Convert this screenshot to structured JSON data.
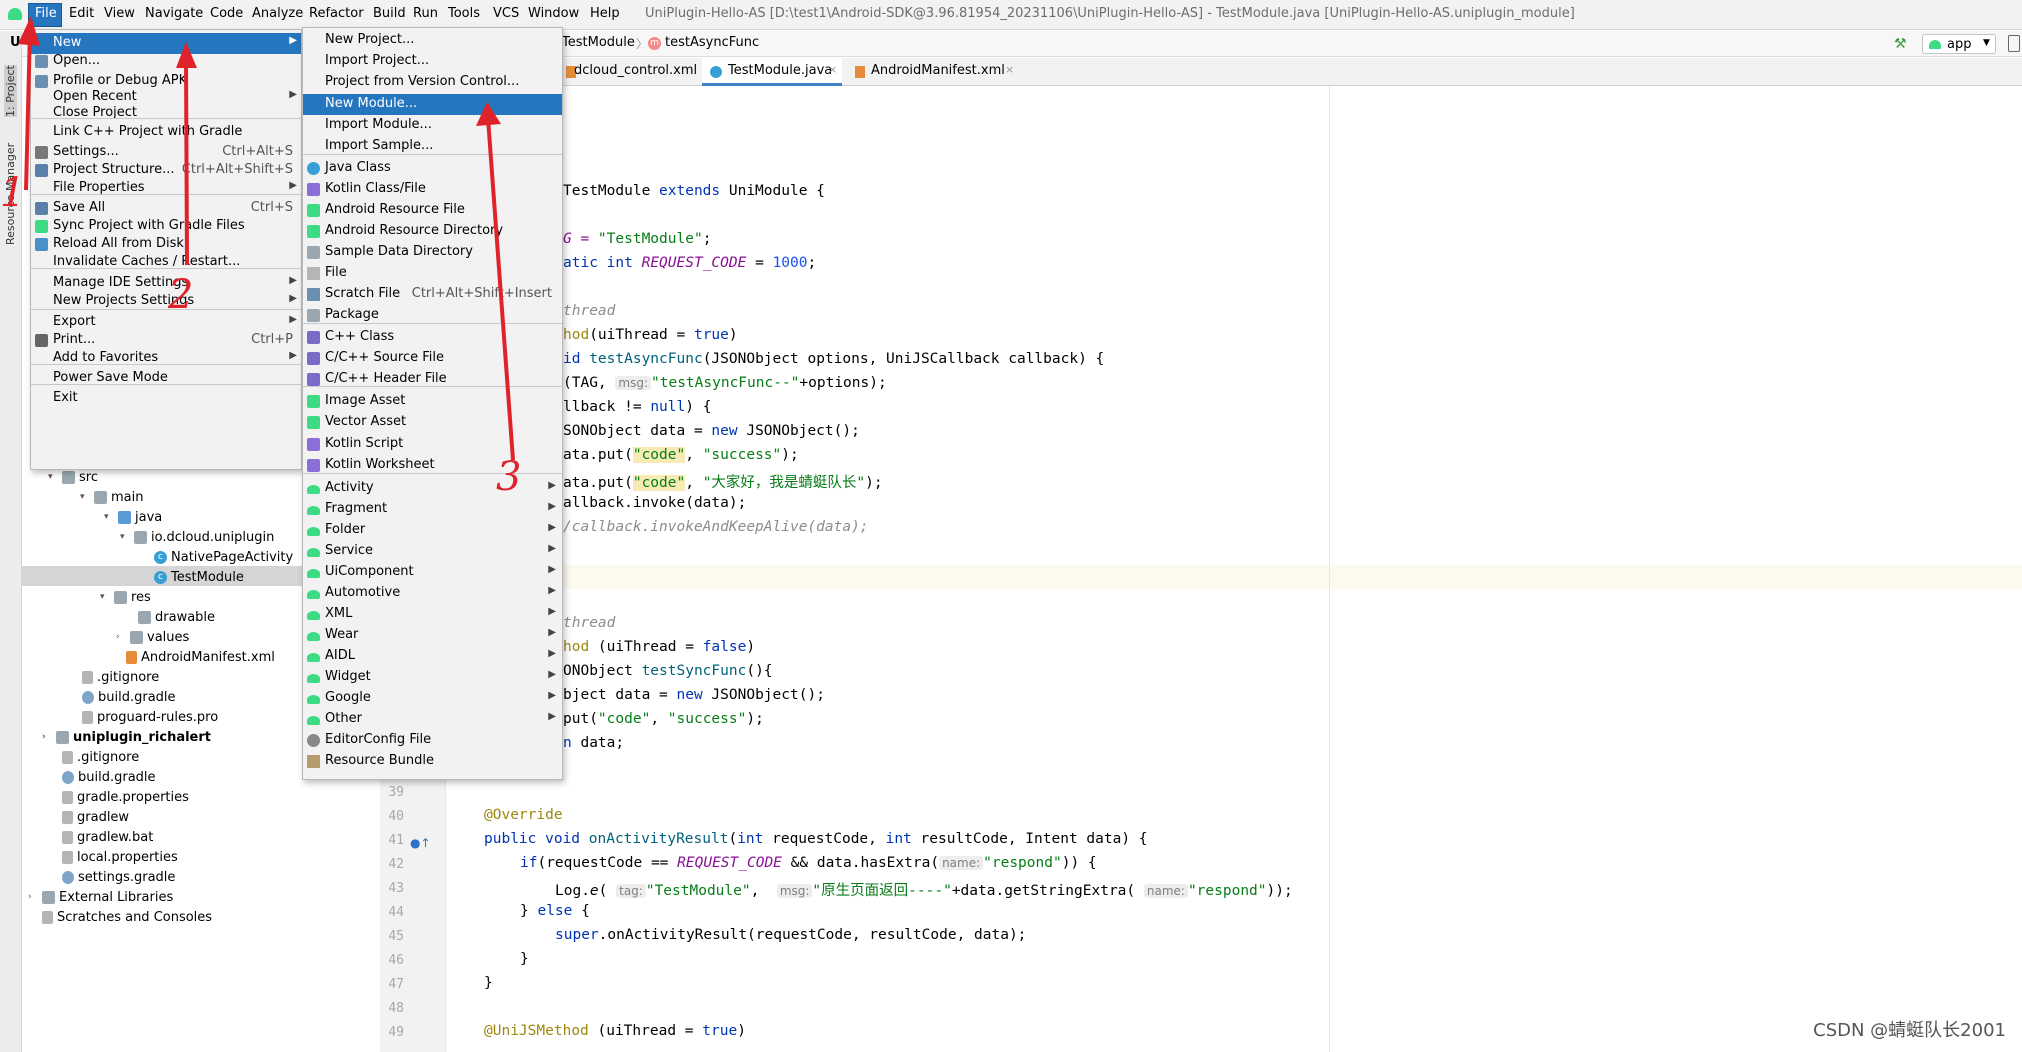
{
  "menubar": {
    "items": [
      "File",
      "Edit",
      "View",
      "Navigate",
      "Code",
      "Analyze",
      "Refactor",
      "Build",
      "Run",
      "Tools",
      "VCS",
      "Window",
      "Help"
    ],
    "window_title": "UniPlugin-Hello-AS [D:\\test1\\Android-SDK@3.96.81954_20231106\\UniPlugin-Hello-AS] - TestModule.java [UniPlugin-Hello-AS.uniplugin_module]"
  },
  "navbar": {
    "crumb_class": "TestModule",
    "crumb_method": "testAsyncFunc",
    "run_config": "app"
  },
  "tabs": [
    "dcloud_control.xml",
    "TestModule.java",
    "AndroidManifest.xml"
  ],
  "left_strip": {
    "project_label": "1: Project",
    "resource_label": "Resource Manager",
    "partial_text": "U"
  },
  "file_menu": {
    "items": [
      {
        "label": "New",
        "shortcut": "",
        "submenu": true
      },
      {
        "label": "Open...",
        "shortcut": ""
      },
      {
        "label": "Profile or Debug APK",
        "shortcut": ""
      },
      {
        "label": "Open Recent",
        "shortcut": "",
        "submenu": true
      },
      {
        "label": "Close Project",
        "shortcut": ""
      },
      {
        "label": "Link C++ Project with Gradle",
        "shortcut": ""
      },
      {
        "label": "Settings...",
        "shortcut": "Ctrl+Alt+S"
      },
      {
        "label": "Project Structure...",
        "shortcut": "Ctrl+Alt+Shift+S"
      },
      {
        "label": "File Properties",
        "shortcut": "",
        "submenu": true
      },
      {
        "label": "Save All",
        "shortcut": "Ctrl+S"
      },
      {
        "label": "Sync Project with Gradle Files",
        "shortcut": ""
      },
      {
        "label": "Reload All from Disk",
        "shortcut": ""
      },
      {
        "label": "Invalidate Caches / Restart...",
        "shortcut": ""
      },
      {
        "label": "Manage IDE Settings",
        "shortcut": "",
        "submenu": true
      },
      {
        "label": "New Projects Settings",
        "shortcut": "",
        "submenu": true
      },
      {
        "label": "Export",
        "shortcut": "",
        "submenu": true
      },
      {
        "label": "Print...",
        "shortcut": "Ctrl+P"
      },
      {
        "label": "Add to Favorites",
        "shortcut": "",
        "submenu": true
      },
      {
        "label": "Power Save Mode",
        "shortcut": ""
      },
      {
        "label": "Exit",
        "shortcut": ""
      }
    ]
  },
  "new_menu": {
    "items": [
      {
        "label": "New Project...",
        "shortcut": ""
      },
      {
        "label": "Import Project...",
        "shortcut": ""
      },
      {
        "label": "Project from Version Control...",
        "shortcut": ""
      },
      {
        "label": "New Module...",
        "shortcut": ""
      },
      {
        "label": "Import Module...",
        "shortcut": ""
      },
      {
        "label": "Import Sample...",
        "shortcut": ""
      },
      {
        "label": "Java Class",
        "shortcut": ""
      },
      {
        "label": "Kotlin Class/File",
        "shortcut": ""
      },
      {
        "label": "Android Resource File",
        "shortcut": ""
      },
      {
        "label": "Android Resource Directory",
        "shortcut": ""
      },
      {
        "label": "Sample Data Directory",
        "shortcut": ""
      },
      {
        "label": "File",
        "shortcut": ""
      },
      {
        "label": "Scratch File",
        "shortcut": "Ctrl+Alt+Shift+Insert"
      },
      {
        "label": "Package",
        "shortcut": ""
      },
      {
        "label": "C++ Class",
        "shortcut": ""
      },
      {
        "label": "C/C++ Source File",
        "shortcut": ""
      },
      {
        "label": "C/C++ Header File",
        "shortcut": ""
      },
      {
        "label": "Image Asset",
        "shortcut": ""
      },
      {
        "label": "Vector Asset",
        "shortcut": ""
      },
      {
        "label": "Kotlin Script",
        "shortcut": ""
      },
      {
        "label": "Kotlin Worksheet",
        "shortcut": ""
      },
      {
        "label": "Activity",
        "submenu": true
      },
      {
        "label": "Fragment",
        "submenu": true
      },
      {
        "label": "Folder",
        "submenu": true
      },
      {
        "label": "Service",
        "submenu": true
      },
      {
        "label": "UiComponent",
        "submenu": true
      },
      {
        "label": "Automotive",
        "submenu": true
      },
      {
        "label": "XML",
        "submenu": true
      },
      {
        "label": "Wear",
        "submenu": true
      },
      {
        "label": "AIDL",
        "submenu": true
      },
      {
        "label": "Widget",
        "submenu": true
      },
      {
        "label": "Google",
        "submenu": true
      },
      {
        "label": "Other",
        "submenu": true
      },
      {
        "label": "EditorConfig File",
        "shortcut": ""
      },
      {
        "label": "Resource Bundle",
        "shortcut": ""
      }
    ]
  },
  "project_tree": [
    {
      "label": "src",
      "type": "folder"
    },
    {
      "label": "main",
      "type": "folder"
    },
    {
      "label": "java",
      "type": "folder-blue"
    },
    {
      "label": "io.dcloud.uniplugin",
      "type": "folder"
    },
    {
      "label": "NativePageActivity",
      "type": "class"
    },
    {
      "label": "TestModule",
      "type": "class"
    },
    {
      "label": "res",
      "type": "folder"
    },
    {
      "label": "drawable",
      "type": "folder"
    },
    {
      "label": "values",
      "type": "folder"
    },
    {
      "label": "AndroidManifest.xml",
      "type": "xml"
    },
    {
      "label": ".gitignore",
      "type": "file"
    },
    {
      "label": "build.gradle",
      "type": "gradle"
    },
    {
      "label": "proguard-rules.pro",
      "type": "file"
    },
    {
      "label": "uniplugin_richalert",
      "type": "folder"
    },
    {
      "label": ".gitignore",
      "type": "file"
    },
    {
      "label": "build.gradle",
      "type": "gradle"
    },
    {
      "label": "gradle.properties",
      "type": "file"
    },
    {
      "label": "gradlew",
      "type": "file"
    },
    {
      "label": "gradlew.bat",
      "type": "file"
    },
    {
      "label": "local.properties",
      "type": "file"
    },
    {
      "label": "settings.gradle",
      "type": "gradle"
    },
    {
      "label": "External Libraries",
      "type": "folder"
    },
    {
      "label": "Scratches and Consoles",
      "type": "file"
    }
  ],
  "editor": {
    "line_numbers": [
      "39",
      "40",
      "41",
      "42",
      "43",
      "44",
      "45",
      "46",
      "47",
      "48",
      "49"
    ],
    "code": {
      "l1a": "TestModule ",
      "l1b": "extends",
      "l1c": " UniModule {",
      "l2a": "G = ",
      "l2b": "\"TestModule\"",
      "l2c": ";",
      "l3a": "atic ",
      "l3b": "int",
      "l3c": " ",
      "l3d": "REQUEST_CODE",
      "l3e": " = ",
      "l3f": "1000",
      "l3g": ";",
      "l4": "thread",
      "l5a": "hod",
      "l5b": "(uiThread = ",
      "l5c": "true",
      "l5d": ")",
      "l6a": "id ",
      "l6b": "testAsyncFunc",
      "l6c": "(JSONObject options, UniJSCallback callback) {",
      "l7a": "(TAG, ",
      "l7h": "msg:",
      "l7b": "\"testAsyncFunc--\"",
      "l7c": "+options);",
      "l8a": "llback != ",
      "l8b": "null",
      "l8c": ") {",
      "l9a": "SONObject data = ",
      "l9b": "new",
      "l9c": " JSONObject();",
      "l10a": "ata.put(",
      "l10b": "\"code\"",
      "l10c": ", ",
      "l10d": "\"success\"",
      "l10e": ");",
      "l11a": "ata.put(",
      "l11b": "\"code\"",
      "l11c": ", ",
      "l11d": "\"大家好，我是蜻蜓队长\"",
      "l11e": ");",
      "l12": "allback.invoke(data);",
      "l13": "/callback.invokeAndKeepAlive(data);",
      "l14": "thread",
      "l15a": "hod ",
      "l15b": "(uiThread = ",
      "l15c": "false",
      "l15d": ")",
      "l16a": "ONObject ",
      "l16b": "testSyncFunc",
      "l16c": "(){",
      "l17a": "bject data = ",
      "l17b": "new",
      "l17c": " JSONObject();",
      "l18a": "put(",
      "l18b": "\"code\"",
      "l18c": ", ",
      "l18d": "\"success\"",
      "l18e": ");",
      "l19a": "n ",
      "l19b": "data;",
      "l40": "@Override",
      "l41a": "public void ",
      "l41b": "onActivityResult",
      "l41c": "(",
      "l41d": "int",
      "l41e": " requestCode, ",
      "l41f": "int",
      "l41g": " resultCode, Intent data) {",
      "l42a": "if",
      "l42b": "(requestCode == ",
      "l42c": "REQUEST_CODE",
      "l42d": " && data.hasExtra(",
      "l42h": "name:",
      "l42e": "\"respond\"",
      "l42f": ")) {",
      "l43a": "Log.",
      "l43b": "e",
      "l43c": "( ",
      "l43h": "tag:",
      "l43d": "\"TestModule\"",
      "l43e": ",  ",
      "l43h2": "msg:",
      "l43f": "\"原生页面返回----\"",
      "l43g": "+data.getStringExtra( ",
      "l43h3": "name:",
      "l43i": "\"respond\"",
      "l43j": "));",
      "l44a": "} ",
      "l44b": "else",
      "l44c": " {",
      "l45a": "super",
      "l45b": ".onActivityResult(requestCode, resultCode, data);",
      "l46": "}",
      "l47": "}",
      "l49a": "@UniJSMethod",
      "l49b": " (uiThread = ",
      "l49c": "true",
      "l49d": ")"
    }
  },
  "annotations": [
    "1",
    "2",
    "3"
  ],
  "watermark": "CSDN @蜻蜓队长2001",
  "colors": {
    "selection": "#2675bf",
    "annotation": "#e0232a",
    "android_green": "#3ddc84"
  }
}
